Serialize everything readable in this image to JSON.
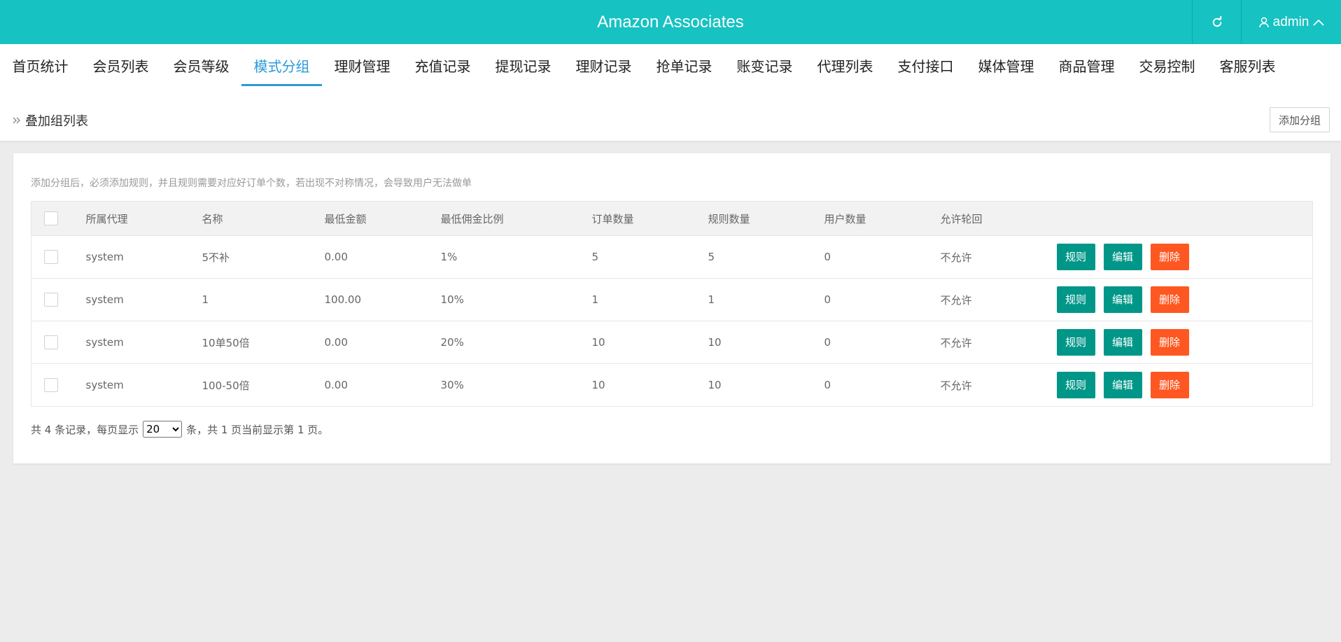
{
  "header": {
    "title": "Amazon Associates",
    "user": "admin"
  },
  "nav": {
    "tabs": [
      "首页统计",
      "会员列表",
      "会员等级",
      "模式分组",
      "理财管理",
      "充值记录",
      "提现记录",
      "理财记录",
      "抢单记录",
      "账变记录",
      "代理列表",
      "支付接口",
      "媒体管理",
      "商品管理",
      "交易控制",
      "客服列表"
    ],
    "active_index": 3
  },
  "breadcrumb": {
    "label": "叠加组列表",
    "add_button": "添加分组"
  },
  "panel": {
    "tip": "添加分组后，必须添加规则，并且规则需要对应好订单个数，若出现不对称情况，会导致用户无法做单",
    "columns": [
      "所属代理",
      "名称",
      "最低金额",
      "最低佣金比例",
      "订单数量",
      "规则数量",
      "用户数量",
      "允许轮回"
    ],
    "rows": [
      {
        "agent": "system",
        "name": "5不补",
        "min_amount": "0.00",
        "min_ratio": "1%",
        "orders": "5",
        "rules": "5",
        "users": "0",
        "loop": "不允许"
      },
      {
        "agent": "system",
        "name": "1",
        "min_amount": "100.00",
        "min_ratio": "10%",
        "orders": "1",
        "rules": "1",
        "users": "0",
        "loop": "不允许"
      },
      {
        "agent": "system",
        "name": "10单50倍",
        "min_amount": "0.00",
        "min_ratio": "20%",
        "orders": "10",
        "rules": "10",
        "users": "0",
        "loop": "不允许"
      },
      {
        "agent": "system",
        "name": "100-50倍",
        "min_amount": "0.00",
        "min_ratio": "30%",
        "orders": "10",
        "rules": "10",
        "users": "0",
        "loop": "不允许"
      }
    ],
    "actions": {
      "rule": "规则",
      "edit": "编辑",
      "delete": "删除"
    }
  },
  "pager": {
    "prefix": "共 4 条记录，每页显示",
    "page_size": "20",
    "suffix": "条，共 1 页当前显示第 1 页。"
  },
  "colors": {
    "header": "#16c2c2",
    "active_tab": "#2b9ad9",
    "teal_button": "#009688",
    "delete_button": "#ff5722"
  }
}
